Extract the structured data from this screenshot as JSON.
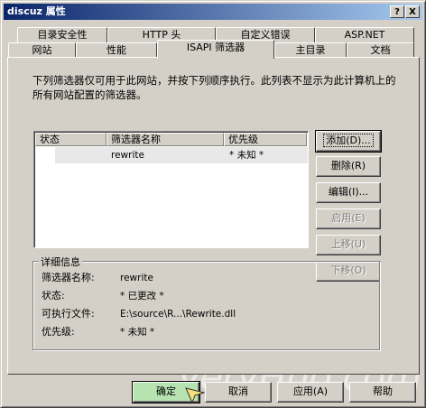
{
  "window": {
    "title": "discuz 属性",
    "help_btn": "?",
    "close_btn": "X"
  },
  "tabs_top": [
    {
      "label": "目录安全性"
    },
    {
      "label": "HTTP 头"
    },
    {
      "label": "自定义错误"
    },
    {
      "label": "ASP.NET"
    }
  ],
  "tabs_bottom": [
    {
      "label": "网站"
    },
    {
      "label": "性能"
    },
    {
      "label": "ISAPI 筛选器"
    },
    {
      "label": "主目录"
    },
    {
      "label": "文档"
    }
  ],
  "description": "下列筛选器仅可用于此网站，并按下列顺序执行。此列表不显示为此计算机上的所有网站配置的筛选器。",
  "filter_list": {
    "columns": [
      "状态",
      "筛选器名称",
      "优先级"
    ],
    "rows": [
      {
        "status": "",
        "name": "rewrite",
        "priority": "* 未知 *"
      }
    ]
  },
  "side_buttons": {
    "add": "添加(D)...",
    "remove": "删除(R)",
    "edit": "编辑(I)...",
    "enable": "启用(E)",
    "move_up": "上移(U)",
    "move_down": "下移(O)"
  },
  "details": {
    "title": "详细信息",
    "name_label": "筛选器名称:",
    "name_value": "rewrite",
    "status_label": "状态:",
    "status_value": "* 已更改 *",
    "exec_label": "可执行文件:",
    "exec_value": "E:\\source\\R...\\Rewrite.dll",
    "priority_label": "优先级:",
    "priority_value": "* 未知 *"
  },
  "footer_buttons": {
    "ok": "确定",
    "cancel": "取消",
    "apply": "应用(A)",
    "help": "帮助"
  },
  "watermark": "VeryHuo.com"
}
